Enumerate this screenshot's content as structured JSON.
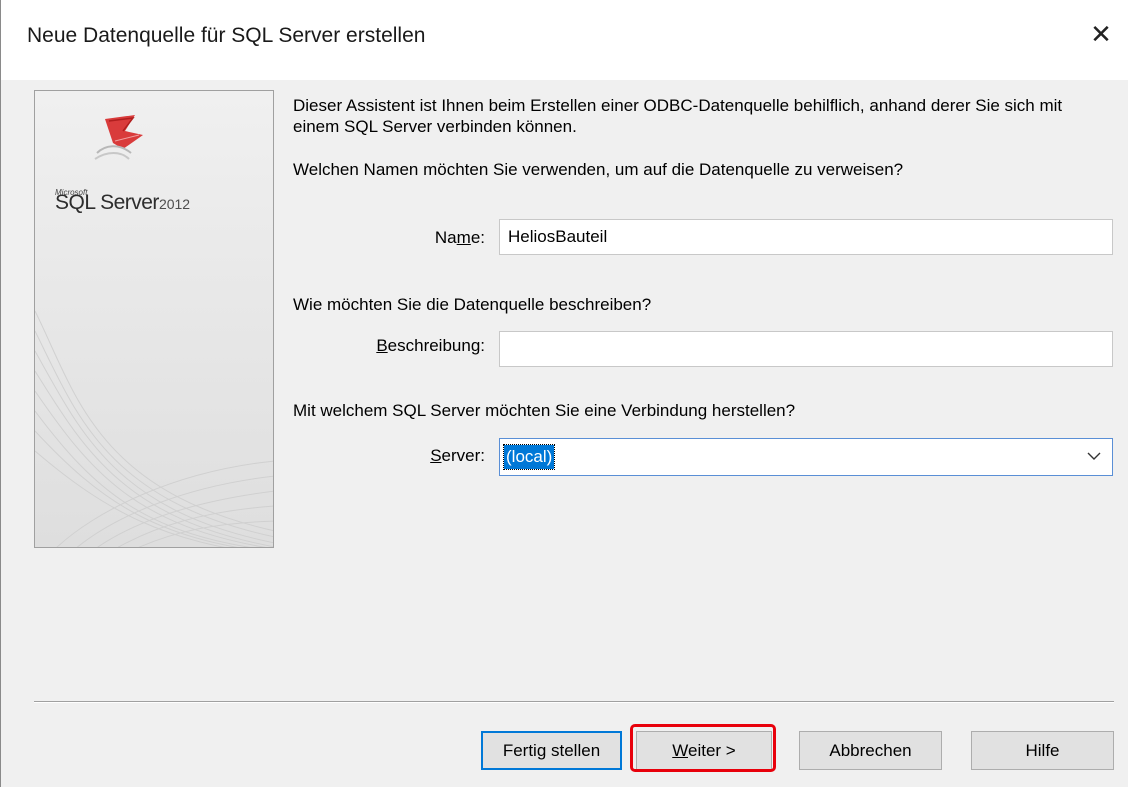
{
  "window": {
    "title": "Neue Datenquelle für SQL Server erstellen",
    "close_glyph": "✕"
  },
  "branding": {
    "brand_small": "Microsoft",
    "product": "SQL Server",
    "version": "2012",
    "logo_icon": "sql-server-logo-icon",
    "accent_color": "#cc2a2a"
  },
  "content": {
    "intro": "Dieser Assistent ist Ihnen beim Erstellen einer ODBC-Datenquelle behilflich, anhand derer Sie sich mit einem SQL Server verbinden können.",
    "question_name": "Welchen Namen möchten Sie verwenden, um auf die Datenquelle zu verweisen?",
    "question_desc": "Wie möchten Sie die Datenquelle beschreiben?",
    "question_server": "Mit welchem SQL Server möchten Sie eine Verbindung herstellen?"
  },
  "form": {
    "name_label_pre": "Na",
    "name_label_acc": "m",
    "name_label_post": "e:",
    "name_value": "HeliosBauteil",
    "desc_label_acc": "B",
    "desc_label_post": "eschreibung:",
    "desc_value": "",
    "server_label_acc": "S",
    "server_label_post": "erver:",
    "server_value": "(local)",
    "server_dropdown_icon": "chevron-down-icon"
  },
  "buttons": {
    "finish": "Fertig stellen",
    "next_acc": "W",
    "next_post": "eiter >",
    "cancel": "Abbrechen",
    "help": "Hilfe"
  },
  "highlight_color": "#e8000b"
}
